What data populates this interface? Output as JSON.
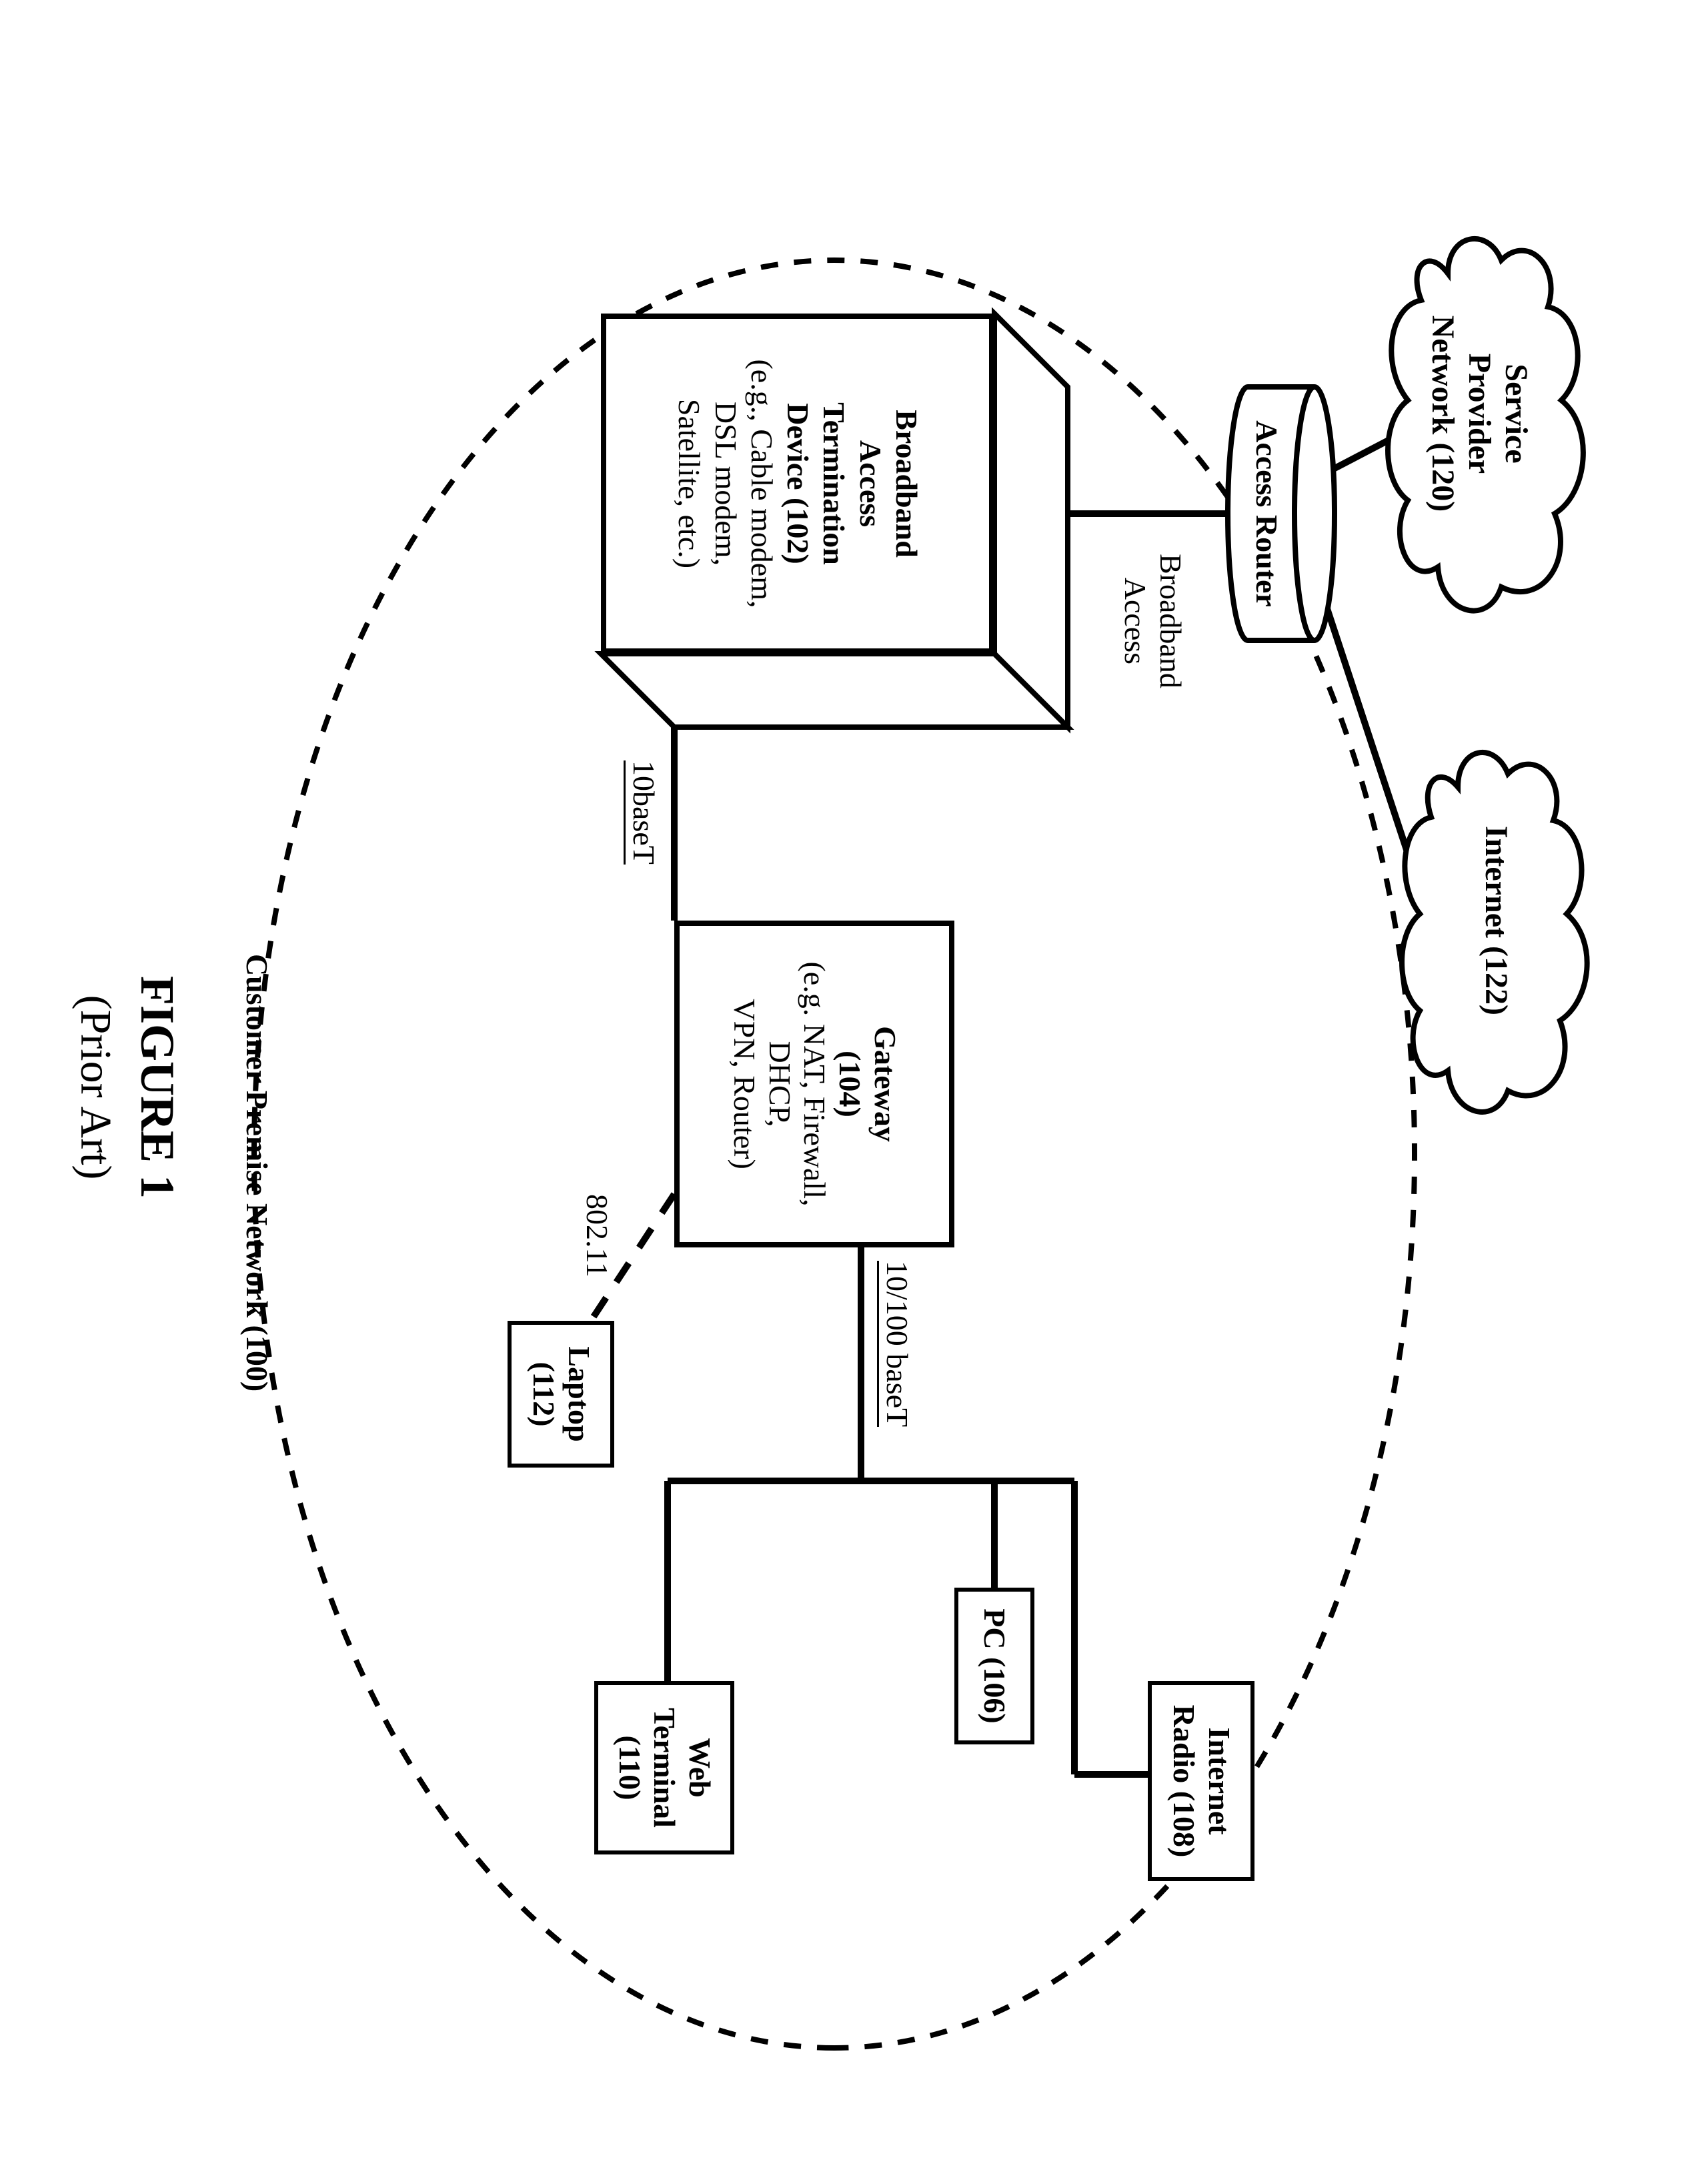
{
  "figure": {
    "title": "FIGURE 1",
    "subtitle": "(Prior Art)"
  },
  "clouds": {
    "spn": {
      "l1": "Service",
      "l2": "Provider",
      "l3": "Network (120)"
    },
    "internet": "Internet (122)"
  },
  "access_router": "Access Router",
  "links": {
    "broadband_access_1": "Broadband",
    "broadband_access_2": "Access",
    "tenbaset": "10baseT",
    "lan": "10/100 baseT",
    "wifi": "802.11"
  },
  "modem": {
    "l1": "Broadband",
    "l2": "Access",
    "l3": "Termination",
    "l4": "Device (102)",
    "s1": "(e.g., Cable modem,",
    "s2": "DSL modem,",
    "s3": "Satellite, etc.)"
  },
  "gateway": {
    "l1": "Gateway",
    "l2": "(104)",
    "s1": "(e.g. NAT, Firewall,",
    "s2": "DHCP,",
    "s3": "VPN, Router)"
  },
  "devices": {
    "pc": "PC (106)",
    "radio_l1": "Internet",
    "radio_l2": "Radio (108)",
    "web_l1": "Web",
    "web_l2": "Terminal",
    "web_l3": "(110)",
    "laptop_l1": "Laptop",
    "laptop_l2": "(112)"
  },
  "cpn": "Customer Premise Network (100)"
}
